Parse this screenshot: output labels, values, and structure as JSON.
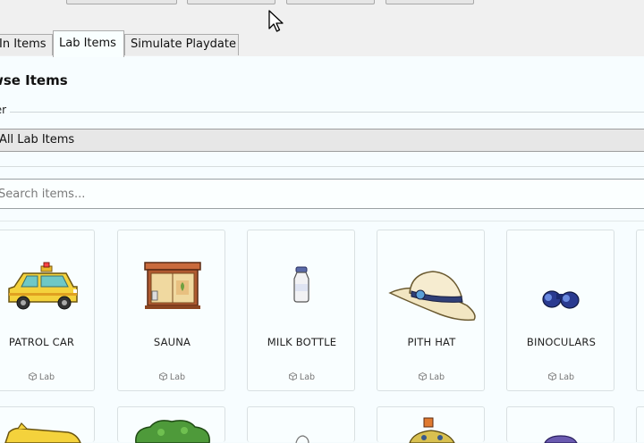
{
  "tabs": [
    {
      "label": "In Items",
      "active": false
    },
    {
      "label": "Lab Items",
      "active": true
    },
    {
      "label": "Simulate Playdate",
      "active": false
    }
  ],
  "panel": {
    "title": "wse Items",
    "filter_label": "ter",
    "filter_value": "All Lab Items",
    "search_placeholder": "Search items..."
  },
  "items": [
    {
      "name": "PATROL CAR",
      "category": "Lab",
      "icon": "patrol-car-icon"
    },
    {
      "name": "SAUNA",
      "category": "Lab",
      "icon": "sauna-icon"
    },
    {
      "name": "MILK BOTTLE",
      "category": "Lab",
      "icon": "milk-bottle-icon"
    },
    {
      "name": "PITH HAT",
      "category": "Lab",
      "icon": "pith-hat-icon"
    },
    {
      "name": "BINOCULARS",
      "category": "Lab",
      "icon": "binoculars-icon"
    }
  ],
  "colors": {
    "accent": "#f4d23c",
    "panel_bg": "#f7fdff"
  }
}
